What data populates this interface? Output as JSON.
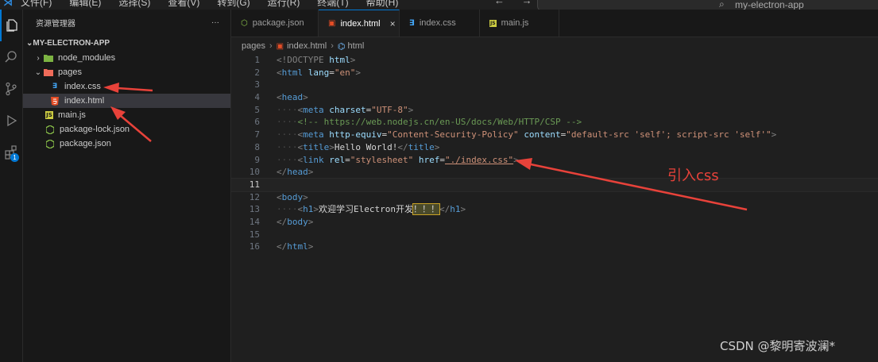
{
  "menu": [
    "文件(F)",
    "编辑(E)",
    "选择(S)",
    "查看(V)",
    "转到(G)",
    "运行(R)",
    "终端(T)",
    "帮助(H)"
  ],
  "nav_back": "←",
  "nav_forward": "→",
  "search": {
    "text": "my-electron-app"
  },
  "activity_badge": "1",
  "sidebar": {
    "title": "资源管理器",
    "more": "···",
    "section": "MY-ELECTRON-APP",
    "items": [
      {
        "label": "node_modules",
        "icon": "folder-icon",
        "depth": 0,
        "expanded": false
      },
      {
        "label": "pages",
        "icon": "folder-open-icon",
        "depth": 0,
        "expanded": true
      },
      {
        "label": "index.css",
        "icon": "css-file-icon",
        "depth": 1
      },
      {
        "label": "index.html",
        "icon": "html-file-icon",
        "depth": 1,
        "selected": true
      },
      {
        "label": "main.js",
        "icon": "js-file-icon",
        "depth": 0
      },
      {
        "label": "package-lock.json",
        "icon": "json-file-icon",
        "depth": 0
      },
      {
        "label": "package.json",
        "icon": "json-file-icon",
        "depth": 0
      }
    ]
  },
  "tabs": [
    {
      "label": "package.json",
      "icon": "json-file-icon",
      "active": false
    },
    {
      "label": "index.html",
      "icon": "html-file-icon",
      "active": true,
      "close": "×"
    },
    {
      "label": "index.css",
      "icon": "css-file-icon",
      "active": false
    },
    {
      "label": "main.js",
      "icon": "js-file-icon",
      "active": false
    }
  ],
  "breadcrumb": {
    "folder": "pages",
    "file": "index.html",
    "symbol": "html"
  },
  "code": {
    "current_line": 11,
    "lines": [
      "<!DOCTYPE html>",
      "<html lang=\"en\">",
      "",
      "<head>",
      "····<meta charset=\"UTF-8\">",
      "····<!-- https://web.nodejs.cn/en-US/docs/Web/HTTP/CSP -->",
      "····<meta http-equiv=\"Content-Security-Policy\" content=\"default-src 'self'; script-src 'self'\">",
      "····<title>Hello World!</title>",
      "····<link rel=\"stylesheet\" href=\"./index.css\">",
      "</head>",
      "",
      "<body>",
      "····<h1>欢迎学习Electron开发！！！</h1>",
      "</body>",
      "",
      "</html>"
    ]
  },
  "annotation": "引入css",
  "watermark": "CSDN @黎明寄波澜*",
  "colors": {
    "accent": "#0078d4",
    "arrow": "#e8423a",
    "html_icon": "#e44d26",
    "css_icon": "#42a5f5",
    "js_icon": "#cbcb41",
    "json_icon": "#8bc34a"
  }
}
